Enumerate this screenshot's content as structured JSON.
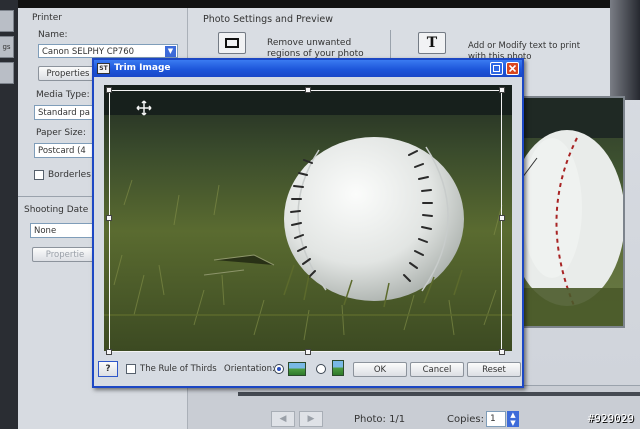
{
  "main_window": {
    "side_tabs": [
      "gs"
    ],
    "printer_panel": {
      "printer_heading": "Printer",
      "name_label": "Name:",
      "name_value": "Canon SELPHY CP760",
      "properties_label": "Properties",
      "media_type_label": "Media Type:",
      "media_type_value": "Standard pa",
      "paper_size_label": "Paper Size:",
      "paper_size_value": "Postcard (4",
      "borderless_label": "Borderles",
      "borderless_checked": false
    },
    "shooting_date_panel": {
      "heading": "Shooting Date",
      "value": "None",
      "properties_label": "Propertie"
    },
    "photo_settings": {
      "heading": "Photo Settings and Preview",
      "trim_description": "Remove unwanted regions of your photo",
      "text_description": "Add or Modify text to print with this photo",
      "text_tool_glyph": "T"
    },
    "footer": {
      "prev_glyph": "◀",
      "next_glyph": "▶",
      "photo_counter": "Photo: 1/1",
      "copies_label": "Copies:",
      "copies_value": "1"
    }
  },
  "trim_dialog": {
    "title": "Trim Image",
    "icon_text": "ST",
    "rule_of_thirds_label": "The Rule of Thirds",
    "rule_of_thirds_checked": false,
    "orientation_label": "Orientation:",
    "orientation_selected": "landscape",
    "help_label": "?",
    "ok_label": "OK",
    "cancel_label": "Cancel",
    "reset_label": "Reset"
  },
  "watermark": "#929029",
  "colors": {
    "title_bar": "#1d56da",
    "close_button": "#d9471e",
    "panel_bg": "#d7dbe1",
    "accent_blue": "#3d6bd9"
  },
  "icons": {
    "trim_tool": "trim-frame-icon",
    "text_tool": "text-t-icon",
    "close": "close-icon",
    "maximize": "maximize-icon",
    "move_cursor": "move-cursor-icon",
    "landscape": "landscape-orientation-icon",
    "portrait": "portrait-orientation-icon"
  }
}
